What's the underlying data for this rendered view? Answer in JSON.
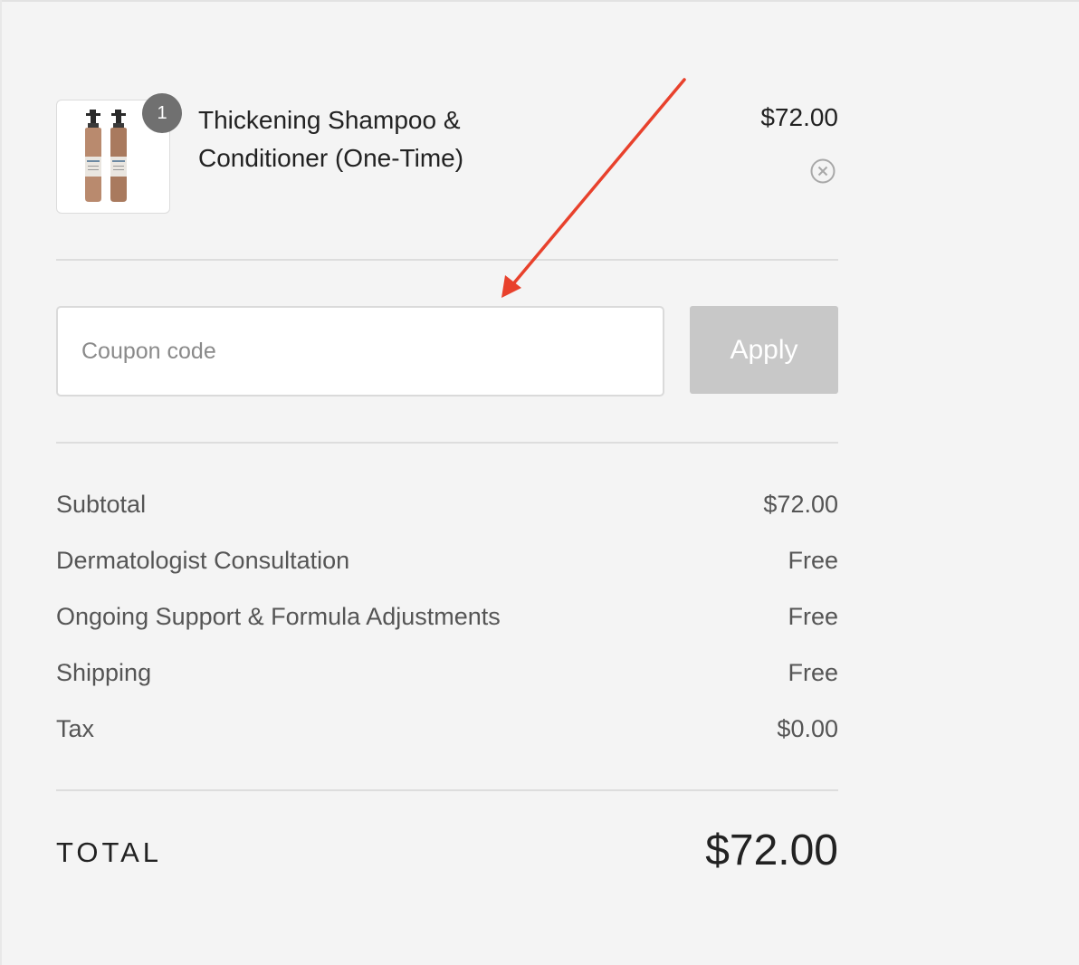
{
  "cart": {
    "item": {
      "name": "Thickening Shampoo & Conditioner (One-Time)",
      "quantity": "1",
      "price": "$72.00",
      "thumbnail_icon": "shampoo-bottles-icon",
      "remove_icon": "remove-circle-x-icon"
    }
  },
  "coupon": {
    "placeholder": "Coupon code",
    "apply_label": "Apply"
  },
  "summary": {
    "lines": [
      {
        "label": "Subtotal",
        "value": "$72.00"
      },
      {
        "label": "Dermatologist Consultation",
        "value": "Free"
      },
      {
        "label": "Ongoing Support & Formula Adjustments",
        "value": "Free"
      },
      {
        "label": "Shipping",
        "value": "Free"
      },
      {
        "label": "Tax",
        "value": "$0.00"
      }
    ],
    "total_label": "TOTAL",
    "total_value": "$72.00"
  },
  "colors": {
    "background": "#f4f4f4",
    "annotation_arrow": "#e8412c",
    "apply_button_disabled": "#c8c8c8",
    "badge": "#707070"
  }
}
